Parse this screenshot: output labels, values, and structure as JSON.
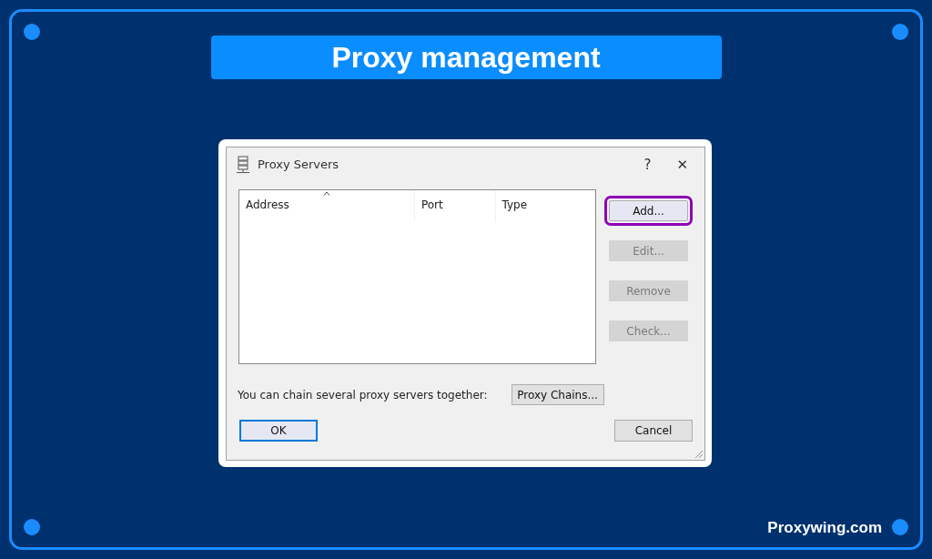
{
  "banner": {
    "title": "Proxy management"
  },
  "dialog": {
    "title": "Proxy Servers",
    "title_buttons": [
      "?",
      "✕"
    ],
    "list": {
      "columns": [
        {
          "label": "Address",
          "sorted": true
        },
        {
          "label": "Port",
          "sorted": false
        },
        {
          "label": "Type",
          "sorted": false
        }
      ]
    },
    "side_buttons": [
      {
        "label": "Add...",
        "disabled": false,
        "highlighted": true
      },
      {
        "label": "Edit...",
        "disabled": true,
        "highlighted": false
      },
      {
        "label": "Remove",
        "disabled": true,
        "highlighted": false
      },
      {
        "label": "Check...",
        "disabled": true,
        "highlighted": false
      }
    ],
    "chain_text": "You can chain several proxy servers together:",
    "chain_button": "Proxy Chains...",
    "ok_button": {
      "label": "OK",
      "default": true
    },
    "cancel_button": {
      "label": "Cancel",
      "default": false
    }
  },
  "footer": {
    "site": "Proxywing.com"
  }
}
